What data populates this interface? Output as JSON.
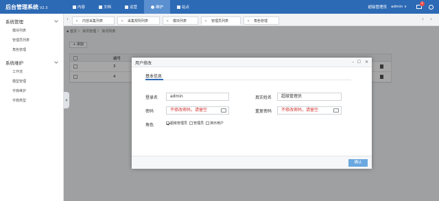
{
  "app": {
    "title": "后台管理系统",
    "version": "V2.3"
  },
  "topnav": [
    {
      "label": "内容",
      "icon": "home-icon"
    },
    {
      "label": "文档",
      "icon": "document-icon"
    },
    {
      "label": "运营",
      "icon": "operations-icon"
    },
    {
      "label": "维护",
      "icon": "gear-icon",
      "active": true
    },
    {
      "label": "站点",
      "icon": "chart-icon"
    }
  ],
  "user": {
    "role": "超级管理员",
    "name": "admin",
    "mail_count": "1"
  },
  "sidebar": {
    "groups": [
      {
        "label": "系统管理",
        "items": [
          "模块列表",
          "管理员列表",
          "角色管理"
        ]
      },
      {
        "label": "系统维护",
        "items": [
          "工作流",
          "模型管理",
          "字典维护",
          "字典类型"
        ]
      }
    ]
  },
  "tabs": [
    {
      "label": "内容采集列表"
    },
    {
      "label": "采集规则列表"
    },
    {
      "label": "模块列表"
    },
    {
      "label": "管理员列表",
      "active": true
    },
    {
      "label": "角色管理"
    }
  ],
  "breadcrumb": "首页 〉 资讯管理 〉 资讯列表",
  "toolbar": {
    "add_label": "+ 添加"
  },
  "table": {
    "num_header": "编号",
    "rows": [
      {
        "num": "3"
      },
      {
        "num": "4"
      }
    ]
  },
  "modal": {
    "title": "用户修改",
    "section": "基本信息",
    "fields": {
      "login_label": "登录名",
      "login_value": "admin",
      "realname_label": "真实姓名",
      "realname_value": "超级管理员",
      "password_label": "密码",
      "password_value": "不修改密码，请留空",
      "repeat_label": "重复密码",
      "repeat_value": "不修改密码，请留空",
      "role_label": "角色"
    },
    "roles": [
      {
        "label": "超级管理员",
        "checked": true
      },
      {
        "label": "管理员",
        "checked": false
      },
      {
        "label": "演示用户",
        "checked": false
      }
    ],
    "ok_label": "确认"
  }
}
